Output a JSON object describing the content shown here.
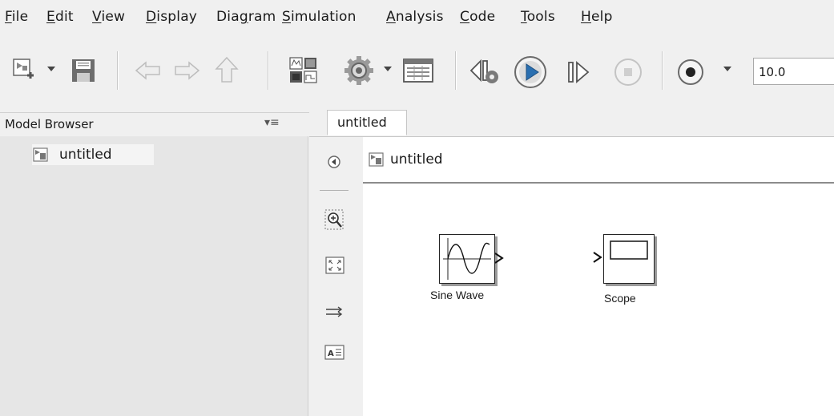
{
  "menu": [
    {
      "label": "File",
      "mnemonic": "F",
      "rest": "ile"
    },
    {
      "label": "Edit",
      "mnemonic": "E",
      "rest": "dit"
    },
    {
      "label": "View",
      "mnemonic": "V",
      "rest": "iew"
    },
    {
      "label": "Display",
      "mnemonic": "D",
      "rest": "isplay"
    },
    {
      "label": "Diagram",
      "pre": "Dia",
      "mnemonic": "g",
      "rest": "ram"
    },
    {
      "label": "Simulation",
      "mnemonic": "S",
      "rest": "imulation"
    },
    {
      "label": "Analysis",
      "mnemonic": "A",
      "rest": "nalysis"
    },
    {
      "label": "Code",
      "mnemonic": "C",
      "rest": "ode"
    },
    {
      "label": "Tools",
      "mnemonic": "T",
      "rest": "ools"
    },
    {
      "label": "Help",
      "mnemonic": "H",
      "rest": "elp"
    }
  ],
  "toolbar": {
    "stop_time": "10.0"
  },
  "model_browser": {
    "title": "Model Browser",
    "menu_glyph": "▾≡",
    "tree_item": "untitled"
  },
  "tabs": [
    {
      "label": "untitled",
      "active": true
    }
  ],
  "address_bar": {
    "label": "untitled"
  },
  "blocks": {
    "sine_wave": {
      "label": "Sine Wave"
    },
    "scope": {
      "label": "Scope"
    }
  },
  "colors": {
    "background": "#f0f0f0",
    "canvas": "#ffffff",
    "panel": "#e6e6e6",
    "run_icon_blue": "#2a6fb0"
  }
}
